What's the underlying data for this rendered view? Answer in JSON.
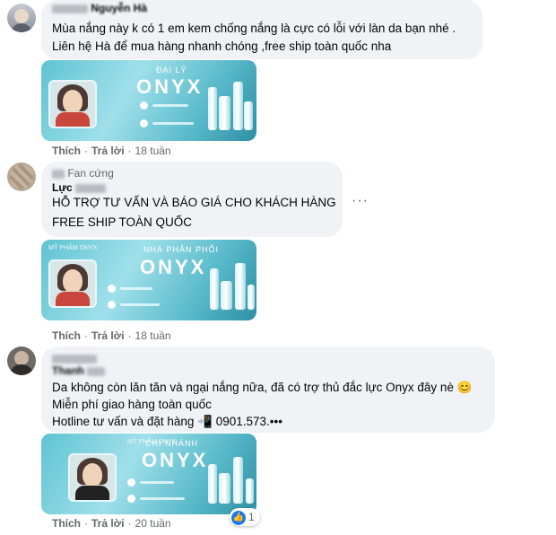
{
  "colors": {
    "bubble": "#f0f2f5",
    "meta": "#65676b",
    "like": "#1877f2",
    "card": "#5fc3d2"
  },
  "comments": [
    {
      "name": "Nguyễn Hà",
      "lines": [
        "Mùa nắng này k có 1 em kem chống nắng là cực có lỗi với làn da bạn nhé .",
        "Liên hệ Hà để mua hàng nhanh chóng ,free ship toàn quốc nha"
      ],
      "card": {
        "sub": "ĐẠI LÝ",
        "brand": "ONYX"
      },
      "like": "Thích",
      "reply": "Trả lời",
      "time": "18 tuần"
    },
    {
      "name": "Lực",
      "badge": "Fan cứng",
      "lines": [
        "HỖ TRỢ TƯ VẤN VÀ BÁO GIÁ CHO KHÁCH HÀNG",
        "FREE SHIP TOÀN QUỐC"
      ],
      "card": {
        "sub": "NHÀ PHÂN PHỐI",
        "top": "MỸ PHẨM ONYX",
        "brand": "ONYX"
      },
      "like": "Thích",
      "reply": "Trả lời",
      "time": "18 tuần",
      "more": "···"
    },
    {
      "name": "Thanh",
      "lines": [
        "Da không còn lăn tăn và ngại nắng nữa, đã có trợ thủ đắc lực Onyx đây nè 😊",
        "Miễn phí giao hàng toàn quốc",
        "Hotline tư vấn và đặt hàng 📲 0901.573.•••"
      ],
      "card": {
        "sub": "CHI NHÁNH",
        "top": "MỸ PHẨM ONYX",
        "brand": "ONYX"
      },
      "like": "Thích",
      "reply": "Trả lời",
      "time": "20 tuần",
      "reactions": "1"
    }
  ]
}
